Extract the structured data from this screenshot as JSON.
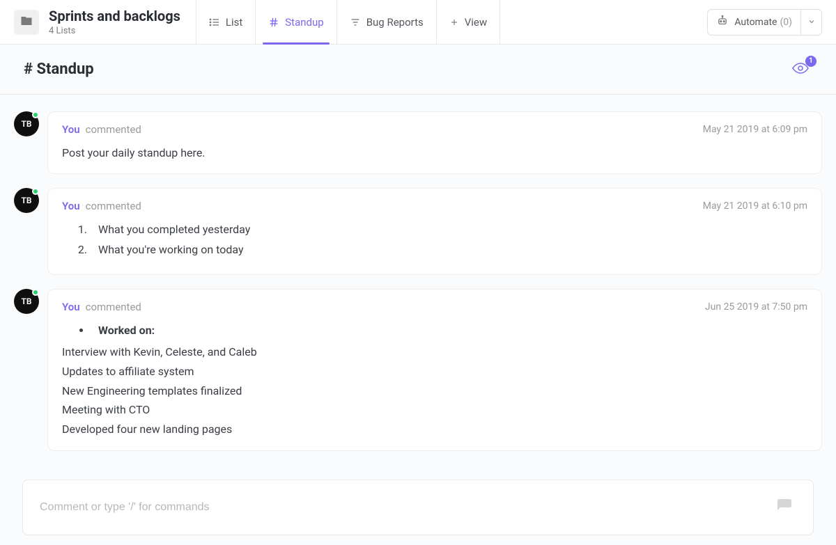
{
  "header": {
    "title": "Sprints and backlogs",
    "subtitle": "4 Lists",
    "tabs": {
      "list": "List",
      "standup": "Standup",
      "bug_reports": "Bug Reports",
      "view": "View"
    },
    "automate_label": "Automate",
    "automate_count": "(0)"
  },
  "sub_header": {
    "title": "# Standup",
    "watchers": "1"
  },
  "avatar_initials": "TB",
  "posts": [
    {
      "author": "You",
      "action": "commented",
      "timestamp": "May 21 2019 at 6:09 pm",
      "body_text": "Post your daily standup here."
    },
    {
      "author": "You",
      "action": "commented",
      "timestamp": "May 21 2019 at 6:10 pm",
      "ordered": [
        "What you completed yesterday",
        "What you're working on today"
      ]
    },
    {
      "author": "You",
      "action": "commented",
      "timestamp": "Jun 25 2019 at 7:50 pm",
      "bullet_heading": "Worked on:",
      "lines": [
        "Interview with Kevin, Celeste, and Caleb",
        "Updates to affiliate system",
        "New Engineering templates finalized",
        "Meeting with CTO",
        "Developed four new landing pages"
      ]
    }
  ],
  "comment_placeholder": "Comment or type '/' for commands"
}
